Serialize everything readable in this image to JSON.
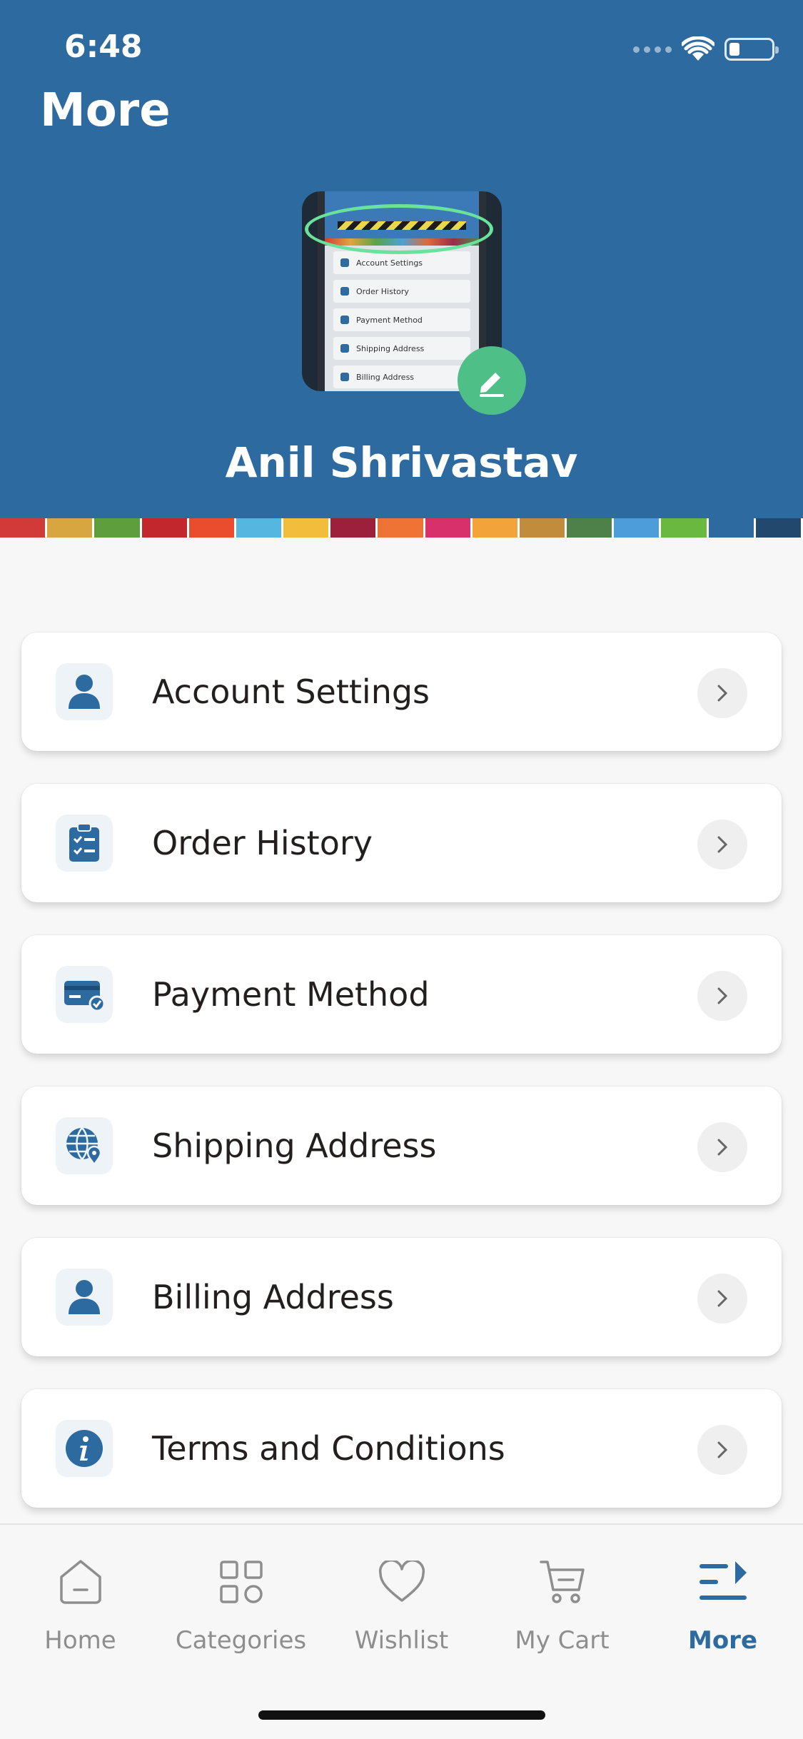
{
  "status_bar": {
    "time": "6:48"
  },
  "header": {
    "title": "More",
    "user_name": "Anil Shrivastav",
    "avatar_preview_rows": [
      "Account Settings",
      "Order History",
      "Payment Method",
      "Shipping Address",
      "Billing Address"
    ]
  },
  "color_strip": [
    "#d23a3a",
    "#d8a640",
    "#5e9e3c",
    "#c1272d",
    "#ea4c2e",
    "#55b7df",
    "#f2bd3a",
    "#9c1f3c",
    "#ef7334",
    "#d8306b",
    "#f2a33a",
    "#c18c3c",
    "#4e8049",
    "#4e9ddb",
    "#6bb841",
    "#2d6a9f",
    "#23486e"
  ],
  "menu": {
    "items": [
      {
        "label": "Account Settings",
        "icon": "user-icon"
      },
      {
        "label": "Order History",
        "icon": "clipboard-check-icon"
      },
      {
        "label": "Payment Method",
        "icon": "credit-card-icon"
      },
      {
        "label": "Shipping Address",
        "icon": "globe-location-icon"
      },
      {
        "label": "Billing Address",
        "icon": "user-icon"
      },
      {
        "label": "Terms and Conditions",
        "icon": "info-icon"
      }
    ]
  },
  "bottom_nav": {
    "items": [
      {
        "label": "Home",
        "icon": "home-icon"
      },
      {
        "label": "Categories",
        "icon": "categories-icon"
      },
      {
        "label": "Wishlist",
        "icon": "heart-icon"
      },
      {
        "label": "My Cart",
        "icon": "cart-icon"
      },
      {
        "label": "More",
        "icon": "more-menu-icon",
        "active": true
      }
    ]
  },
  "colors": {
    "primary": "#2d6a9f",
    "edit_button": "#4fbf88",
    "inactive": "#8e8e8e"
  }
}
